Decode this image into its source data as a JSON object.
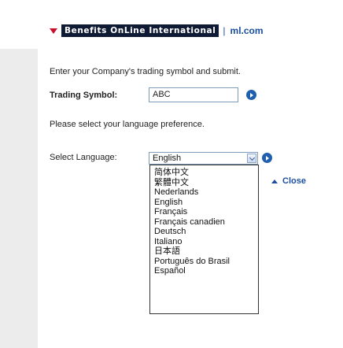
{
  "header": {
    "brand_label": "Benefits OnLine International",
    "separator": "|",
    "link_label": "ml.com"
  },
  "intro_text": "Enter your Company's trading symbol and submit.",
  "trading": {
    "label": "Trading Symbol:",
    "value": "ABC"
  },
  "language_prompt": "Please select your language preference.",
  "language": {
    "label": "Select Language:",
    "selected": "English",
    "options": [
      "简体中文",
      "繁體中文",
      "Nederlands",
      "English",
      "Français",
      "Français canadien",
      "Deutsch",
      "Italiano",
      "日本語",
      "Português do Brasil",
      "Español"
    ]
  },
  "close_label": "Close",
  "colors": {
    "brand_bg": "#0f1b35",
    "accent_red": "#c8102e",
    "link_blue": "#1a4fa0",
    "page_bg": "#ececec"
  }
}
